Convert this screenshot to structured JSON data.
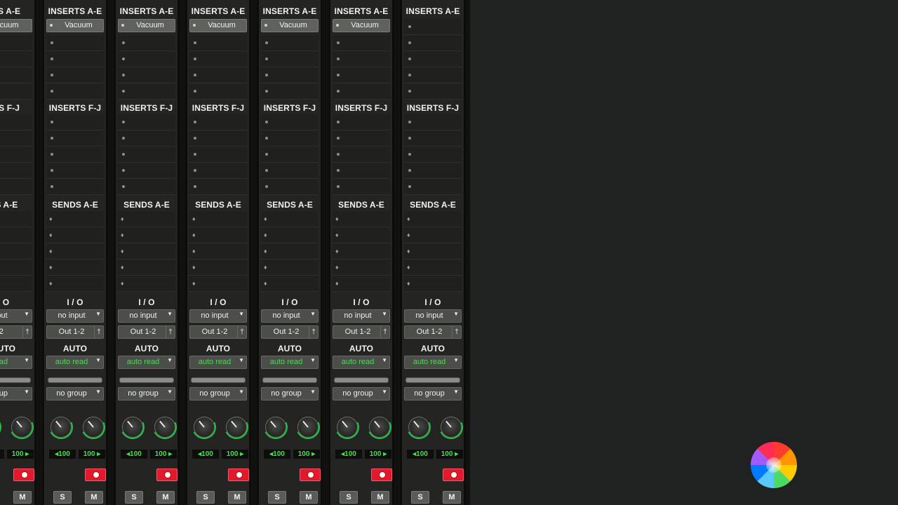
{
  "mixer": {
    "section_titles": {
      "inserts_ae": "INSERTS A-E",
      "inserts_fj": "INSERTS F-J",
      "sends_ae": "SENDS A-E",
      "io": "I / O",
      "auto": "AUTO"
    },
    "partial_titles": {
      "inserts_ae": "RTS A-E",
      "inserts_fj": "RTS F-J",
      "sends_ae": "DS A-E",
      "io": "/ O",
      "auto": "AUTO"
    },
    "strips": [
      {
        "plugin": "acuum",
        "input": "nput",
        "output": "-2",
        "auto": "read",
        "group": "roup",
        "pan_left": "",
        "pan_right": "100",
        "solo": "",
        "mute": "M"
      },
      {
        "plugin": "Vacuum",
        "input": "no input",
        "output": "Out 1-2",
        "auto": "auto read",
        "group": "no group",
        "pan_left": "100",
        "pan_right": "100",
        "solo": "S",
        "mute": "M"
      },
      {
        "plugin": "Vacuum",
        "input": "no input",
        "output": "Out 1-2",
        "auto": "auto read",
        "group": "no group",
        "pan_left": "100",
        "pan_right": "100",
        "solo": "S",
        "mute": "M"
      },
      {
        "plugin": "Vacuum",
        "input": "no input",
        "output": "Out 1-2",
        "auto": "auto read",
        "group": "no group",
        "pan_left": "100",
        "pan_right": "100",
        "solo": "S",
        "mute": "M"
      },
      {
        "plugin": "Vacuum",
        "input": "no input",
        "output": "Out 1-2",
        "auto": "auto read",
        "group": "no group",
        "pan_left": "100",
        "pan_right": "100",
        "solo": "S",
        "mute": "M"
      },
      {
        "plugin": "Vacuum",
        "input": "no input",
        "output": "Out 1-2",
        "auto": "auto read",
        "group": "no group",
        "pan_left": "100",
        "pan_right": "100",
        "solo": "S",
        "mute": "M"
      },
      {
        "plugin": "",
        "input": "no input",
        "output": "Out 1-2",
        "auto": "auto read",
        "group": "no group",
        "pan_left": "100",
        "pan_right": "100",
        "solo": "S",
        "mute": "M"
      }
    ]
  },
  "colors": {
    "auto_read": "#3fe04a",
    "record": "#e01a2c",
    "pan_value": "#45e04f"
  },
  "icons": {
    "busy": "spinning-wait-cursor-icon"
  }
}
